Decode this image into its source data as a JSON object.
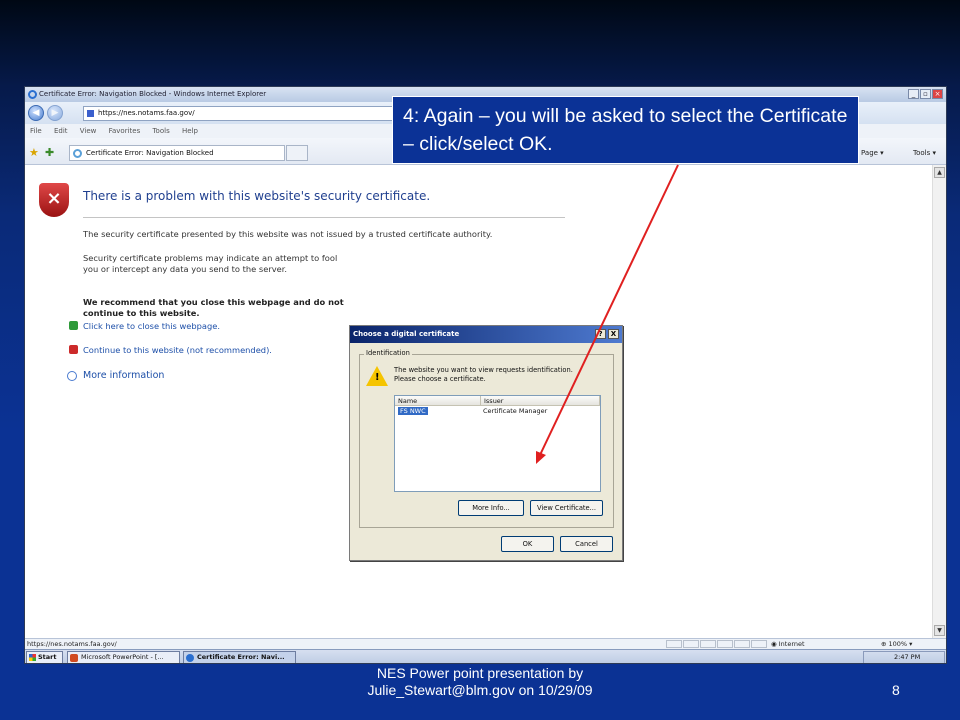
{
  "browser": {
    "window_title": "Certificate Error: Navigation Blocked - Windows Internet Explorer",
    "address": "https://nes.notams.faa.gov/",
    "menu": [
      "File",
      "Edit",
      "View",
      "Favorites",
      "Tools",
      "Help"
    ],
    "tab_title": "Certificate Error: Navigation Blocked",
    "page_menu": "Page ▾",
    "tools_menu": "Tools ▾"
  },
  "error_page": {
    "title": "There is a problem with this website's security certificate.",
    "para1": "The security certificate presented by this website was not issued by a trusted certificate authority.",
    "para2": "Security certificate problems may indicate an attempt to fool you or intercept any data you send to the server.",
    "recommend": "We recommend that you close this webpage and do not continue to this website.",
    "link_close": "Click here to close this webpage.",
    "link_continue": "Continue to this website (not recommended).",
    "link_more": "More information"
  },
  "dialog": {
    "title": "Choose a digital certificate",
    "help_btn": "?",
    "close_btn": "X",
    "group_label": "Identification",
    "message_line1": "The website you want to view requests identification.",
    "message_line2": "Please choose a certificate.",
    "columns": [
      "Name",
      "Issuer"
    ],
    "rows": [
      {
        "name": "FS NWC",
        "issuer": "Certificate Manager"
      }
    ],
    "more_info": "More Info...",
    "view_cert": "View Certificate...",
    "ok": "OK",
    "cancel": "Cancel"
  },
  "status": {
    "url": "https://nes.notams.faa.gov/",
    "zone": "Internet",
    "zoom": "100%"
  },
  "taskbar": {
    "start": "Start",
    "task1": "Microsoft PowerPoint - [...",
    "task2": "Certificate Error: Navi...",
    "time": "2:47 PM"
  },
  "callout": {
    "text": "4: Again – you will be asked to select the Certificate – click/select OK."
  },
  "slide": {
    "footer_line1": "NES Power point presentation by",
    "footer_line2": "Julie_Stewart@blm.gov on 10/29/09",
    "page_number": "8"
  },
  "colors": {
    "slide_background": "#0b3294",
    "callout_background": "#0b3296",
    "arrow": "#e02020"
  }
}
